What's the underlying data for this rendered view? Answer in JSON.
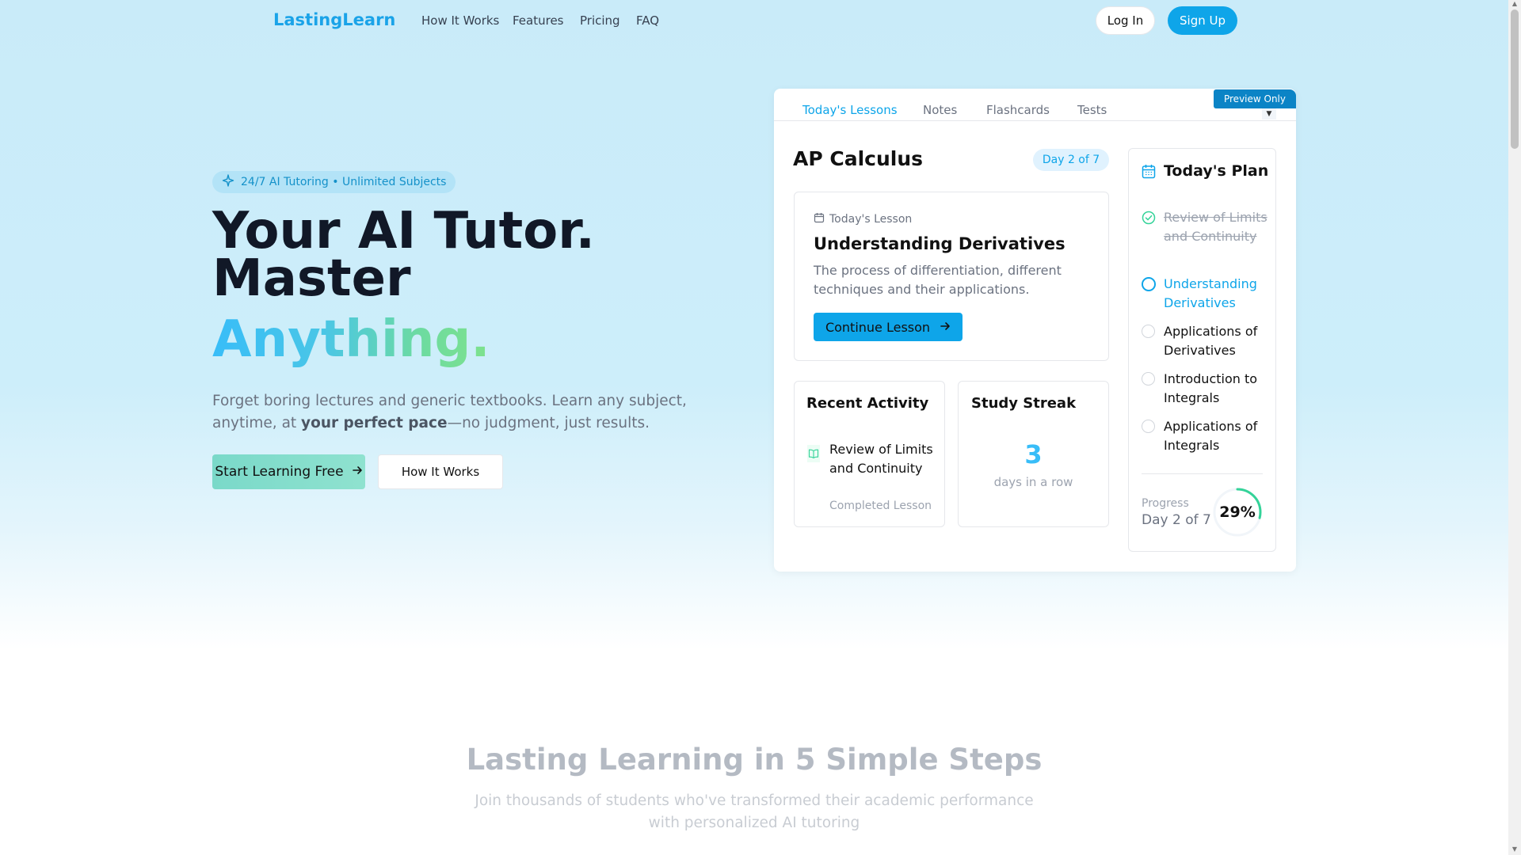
{
  "nav": {
    "logo": "LastingLearn",
    "links": [
      "How It Works",
      "Features",
      "Pricing",
      "FAQ"
    ],
    "login": "Log In",
    "signup": "Sign Up"
  },
  "hero": {
    "badge": "24/7 AI Tutoring • Unlimited Subjects",
    "title_line1": "Your AI Tutor.",
    "title_line2": "Master",
    "title_line3": "Anything.",
    "subtitle_pre": "Forget boring lectures and generic textbooks. Learn any subject, anytime, at ",
    "subtitle_bold": "your perfect pace",
    "subtitle_post": "—no judgment, just results.",
    "cta_primary": "Start Learning Free",
    "cta_secondary": "How It Works"
  },
  "preview": {
    "tag": "Preview Only",
    "tabs": [
      "Today's Lessons",
      "Notes",
      "Flashcards",
      "Tests"
    ],
    "active_tab": "Today's Lessons",
    "course": "AP Calculus",
    "day_pill": "Day 2 of 7",
    "lesson": {
      "label": "Today's Lesson",
      "title": "Understanding Derivatives",
      "description": "The process of differentiation, different techniques and their applications.",
      "button": "Continue Lesson"
    },
    "activity": {
      "title": "Recent Activity",
      "item": "Review of Limits and Continuity",
      "item_sub": "Completed Lesson"
    },
    "streak": {
      "title": "Study Streak",
      "count": "3",
      "label": "days in a row"
    },
    "plan": {
      "title": "Today's Plan",
      "items": [
        {
          "label": "Review of Limits and Continuity",
          "state": "done"
        },
        {
          "label": "Understanding Derivatives",
          "state": "current"
        },
        {
          "label": "Applications of Derivatives",
          "state": "todo"
        },
        {
          "label": "Introduction to Integrals",
          "state": "todo"
        },
        {
          "label": "Applications of Integrals",
          "state": "todo"
        }
      ],
      "progress_label": "Progress",
      "progress_day": "Day 2 of 7",
      "progress_percent": "29%",
      "progress_value": 0.29
    }
  },
  "steps": {
    "title": "Lasting Learning in 5 Simple Steps",
    "subtitle": "Join thousands of students who've transformed their academic performance with personalized AI tutoring"
  },
  "colors": {
    "accent": "#0ea5e9",
    "done": "#34d399",
    "gradient_start": "#38bdf8",
    "gradient_end": "#7ee28d"
  }
}
